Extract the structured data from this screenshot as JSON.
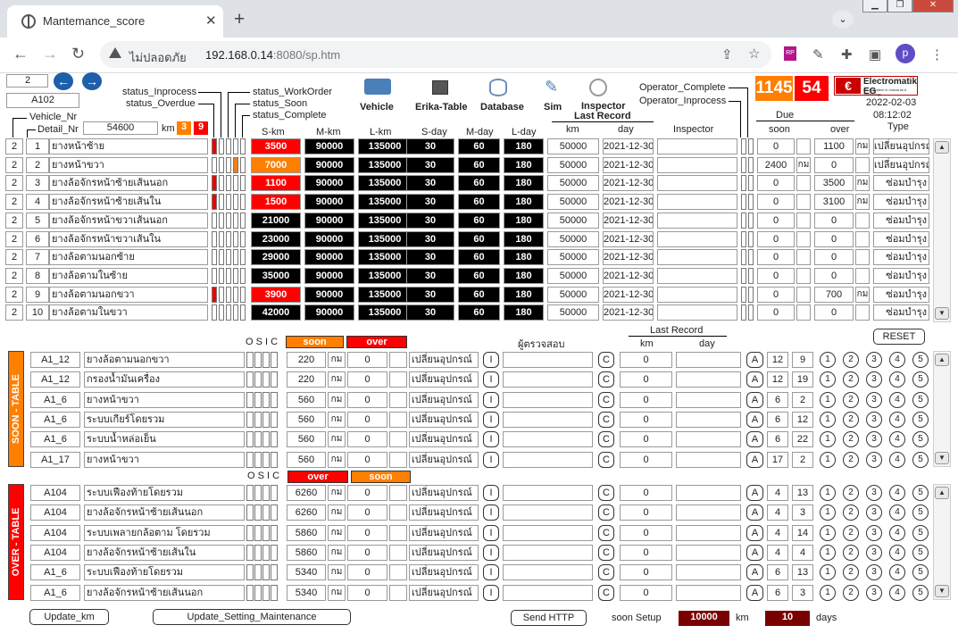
{
  "browser": {
    "tab_title": "Mantemance_score",
    "url_insecure": "ไม่ปลอดภัย",
    "url_host": "192.168.0.14",
    "url_rest": ":8080/sp.htm",
    "avatar": "p"
  },
  "header": {
    "page_num": "2",
    "vehicle_id": "A102",
    "vehicle_nr": "Vehicle_Nr",
    "detail_nr": "Detail_Nr",
    "km_value": "54600",
    "km_unit": "km",
    "soon_count_small": "3",
    "over_count_small": "9",
    "status_inprocess": "status_Inprocess",
    "status_overdue": "status_Overdue",
    "status_workorder": "status_WorkOrder",
    "status_soon": "status_Soon",
    "status_complete": "status_Complete",
    "operator_complete": "Operator_Complete",
    "operator_inprocess": "Operator_Inprocess",
    "soon_count": "1145",
    "over_count": "54",
    "date": "2022-02-03",
    "time": "08:12:02",
    "brand": "Electromatik EG",
    "brand_sub": "Co-operation in Industrial & Technology",
    "nav": {
      "vehicle": "Vehicle",
      "erika": "Erika-Table",
      "database": "Database",
      "sim": "Sim",
      "inspector": "Inspector"
    },
    "cols": {
      "skm": "S-km",
      "mkm": "M-km",
      "lkm": "L-km",
      "sday": "S-day",
      "mday": "M-day",
      "lday": "L-day",
      "last_record": "Last Record",
      "km": "km",
      "day": "day",
      "inspector": "Inspector",
      "due": "Due",
      "soon": "soon",
      "over": "over",
      "type": "Type"
    }
  },
  "colors": {
    "red": "#ff0000",
    "orange": "#ff7f00",
    "dark_red": "#7a0000"
  },
  "main_rows": [
    {
      "n": "2",
      "i": "1",
      "name": "ยางหน้าซ้าย",
      "skm": "3500",
      "skm_c": "red",
      "mkm": "90000",
      "lkm": "135000",
      "sd": "30",
      "md": "60",
      "ld": "180",
      "km": "50000",
      "day": "2021-12-30",
      "soon": "0",
      "su": "",
      "over": "1100",
      "ou": "กม",
      "type": "เปลี่ยนอุปกรณ์",
      "flag": "r"
    },
    {
      "n": "2",
      "i": "2",
      "name": "ยางหน้าขวา",
      "skm": "7000",
      "skm_c": "org",
      "mkm": "90000",
      "lkm": "135000",
      "sd": "30",
      "md": "60",
      "ld": "180",
      "km": "50000",
      "day": "2021-12-30",
      "soon": "2400",
      "su": "กม",
      "over": "0",
      "ou": "",
      "type": "เปลี่ยนอุปกรณ์",
      "flag": "o"
    },
    {
      "n": "2",
      "i": "3",
      "name": "ยางล้อจักรหน้าซ้ายเส้นนอก",
      "skm": "1100",
      "skm_c": "red",
      "mkm": "90000",
      "lkm": "135000",
      "sd": "30",
      "md": "60",
      "ld": "180",
      "km": "50000",
      "day": "2021-12-30",
      "soon": "0",
      "su": "",
      "over": "3500",
      "ou": "กม",
      "type": "ซ่อมบำรุง",
      "flag": "r"
    },
    {
      "n": "2",
      "i": "4",
      "name": "ยางล้อจักรหน้าซ้ายเส้นใน",
      "skm": "1500",
      "skm_c": "red",
      "mkm": "90000",
      "lkm": "135000",
      "sd": "30",
      "md": "60",
      "ld": "180",
      "km": "50000",
      "day": "2021-12-30",
      "soon": "0",
      "su": "",
      "over": "3100",
      "ou": "กม",
      "type": "ซ่อมบำรุง",
      "flag": "r"
    },
    {
      "n": "2",
      "i": "5",
      "name": "ยางล้อจักรหน้าขวาเส้นนอก",
      "skm": "21000",
      "skm_c": "blk",
      "mkm": "90000",
      "lkm": "135000",
      "sd": "30",
      "md": "60",
      "ld": "180",
      "km": "50000",
      "day": "2021-12-30",
      "soon": "0",
      "su": "",
      "over": "0",
      "ou": "",
      "type": "ซ่อมบำรุง",
      "flag": ""
    },
    {
      "n": "2",
      "i": "6",
      "name": "ยางล้อจักรหน้าขวาเส้นใน",
      "skm": "23000",
      "skm_c": "blk",
      "mkm": "90000",
      "lkm": "135000",
      "sd": "30",
      "md": "60",
      "ld": "180",
      "km": "50000",
      "day": "2021-12-30",
      "soon": "0",
      "su": "",
      "over": "0",
      "ou": "",
      "type": "ซ่อมบำรุง",
      "flag": ""
    },
    {
      "n": "2",
      "i": "7",
      "name": "ยางล้อตามนอกซ้าย",
      "skm": "29000",
      "skm_c": "blk",
      "mkm": "90000",
      "lkm": "135000",
      "sd": "30",
      "md": "60",
      "ld": "180",
      "km": "50000",
      "day": "2021-12-30",
      "soon": "0",
      "su": "",
      "over": "0",
      "ou": "",
      "type": "ซ่อมบำรุง",
      "flag": ""
    },
    {
      "n": "2",
      "i": "8",
      "name": "ยางล้อตามในซ้าย",
      "skm": "35000",
      "skm_c": "blk",
      "mkm": "90000",
      "lkm": "135000",
      "sd": "30",
      "md": "60",
      "ld": "180",
      "km": "50000",
      "day": "2021-12-30",
      "soon": "0",
      "su": "",
      "over": "0",
      "ou": "",
      "type": "ซ่อมบำรุง",
      "flag": ""
    },
    {
      "n": "2",
      "i": "9",
      "name": "ยางล้อตามนอกขวา",
      "skm": "3900",
      "skm_c": "red",
      "mkm": "90000",
      "lkm": "135000",
      "sd": "30",
      "md": "60",
      "ld": "180",
      "km": "50000",
      "day": "2021-12-30",
      "soon": "0",
      "su": "",
      "over": "700",
      "ou": "กม",
      "type": "ซ่อมบำรุง",
      "flag": "r"
    },
    {
      "n": "2",
      "i": "10",
      "name": "ยางล้อตามในขวา",
      "skm": "42000",
      "skm_c": "blk",
      "mkm": "90000",
      "lkm": "135000",
      "sd": "30",
      "md": "60",
      "ld": "180",
      "km": "50000",
      "day": "2021-12-30",
      "soon": "0",
      "su": "",
      "over": "0",
      "ou": "",
      "type": "ซ่อมบำรุง",
      "flag": ""
    }
  ],
  "soon_table": {
    "side_label": "SOON - TABLE",
    "osic": "O S I C",
    "col1": "soon",
    "col2": "over",
    "inspector_hdr": "ผู้ตรวจสอบ",
    "last_record": "Last Record",
    "km": "km",
    "day": "day",
    "reset": "RESET",
    "rows": [
      {
        "id": "A1_12",
        "name": "ยางล้อตามนอกขวา",
        "v1": "220",
        "u": "กม",
        "v2": "0",
        "type": "เปลี่ยนอุปกรณ์",
        "km": "0",
        "a1": "12",
        "a2": "9"
      },
      {
        "id": "A1_12",
        "name": "กรองน้ำมันเครื่อง",
        "v1": "220",
        "u": "กม",
        "v2": "0",
        "type": "เปลี่ยนอุปกรณ์",
        "km": "0",
        "a1": "12",
        "a2": "19"
      },
      {
        "id": "A1_6",
        "name": "ยางหน้าขวา",
        "v1": "560",
        "u": "กม",
        "v2": "0",
        "type": "เปลี่ยนอุปกรณ์",
        "km": "0",
        "a1": "6",
        "a2": "2"
      },
      {
        "id": "A1_6",
        "name": "ระบบเกียร์โดยรวม",
        "v1": "560",
        "u": "กม",
        "v2": "0",
        "type": "เปลี่ยนอุปกรณ์",
        "km": "0",
        "a1": "6",
        "a2": "12"
      },
      {
        "id": "A1_6",
        "name": "ระบบน้ำหล่อเย็น",
        "v1": "560",
        "u": "กม",
        "v2": "0",
        "type": "เปลี่ยนอุปกรณ์",
        "km": "0",
        "a1": "6",
        "a2": "22"
      },
      {
        "id": "A1_17",
        "name": "ยางหน้าขวา",
        "v1": "560",
        "u": "กม",
        "v2": "0",
        "type": "เปลี่ยนอุปกรณ์",
        "km": "0",
        "a1": "17",
        "a2": "2"
      }
    ]
  },
  "over_table": {
    "side_label": "OVER - TABLE",
    "osic": "O S I C",
    "col1": "over",
    "col2": "soon",
    "rows": [
      {
        "id": "A104",
        "name": "ระบบเฟืองท้ายโดยรวม",
        "v1": "6260",
        "u": "กม",
        "v2": "0",
        "type": "เปลี่ยนอุปกรณ์",
        "km": "0",
        "a1": "4",
        "a2": "13"
      },
      {
        "id": "A104",
        "name": "ยางล้อจักรหน้าซ้ายเส้นนอก",
        "v1": "6260",
        "u": "กม",
        "v2": "0",
        "type": "เปลี่ยนอุปกรณ์",
        "km": "0",
        "a1": "4",
        "a2": "3"
      },
      {
        "id": "A104",
        "name": "ระบบเพลายกล้อตาม โดยรวม",
        "v1": "5860",
        "u": "กม",
        "v2": "0",
        "type": "เปลี่ยนอุปกรณ์",
        "km": "0",
        "a1": "4",
        "a2": "14"
      },
      {
        "id": "A104",
        "name": "ยางล้อจักรหน้าซ้ายเส้นใน",
        "v1": "5860",
        "u": "กม",
        "v2": "0",
        "type": "เปลี่ยนอุปกรณ์",
        "km": "0",
        "a1": "4",
        "a2": "4"
      },
      {
        "id": "A1_6",
        "name": "ระบบเฟืองท้ายโดยรวม",
        "v1": "5340",
        "u": "กม",
        "v2": "0",
        "type": "เปลี่ยนอุปกรณ์",
        "km": "0",
        "a1": "6",
        "a2": "13"
      },
      {
        "id": "A1_6",
        "name": "ยางล้อจักรหน้าซ้ายเส้นนอก",
        "v1": "5340",
        "u": "กม",
        "v2": "0",
        "type": "เปลี่ยนอุปกรณ์",
        "km": "0",
        "a1": "6",
        "a2": "3"
      }
    ]
  },
  "btn_letters": {
    "i": "I",
    "c": "C",
    "a": "A",
    "nums": [
      "1",
      "2",
      "3",
      "4",
      "5"
    ]
  },
  "footer": {
    "update_km": "Update_km",
    "update_setting": "Update_Setting_Maintenance",
    "send_http": "Send HTTP",
    "soon_setup": "soon Setup",
    "setup_km": "10000",
    "km": "km",
    "setup_days": "10",
    "days": "days"
  }
}
